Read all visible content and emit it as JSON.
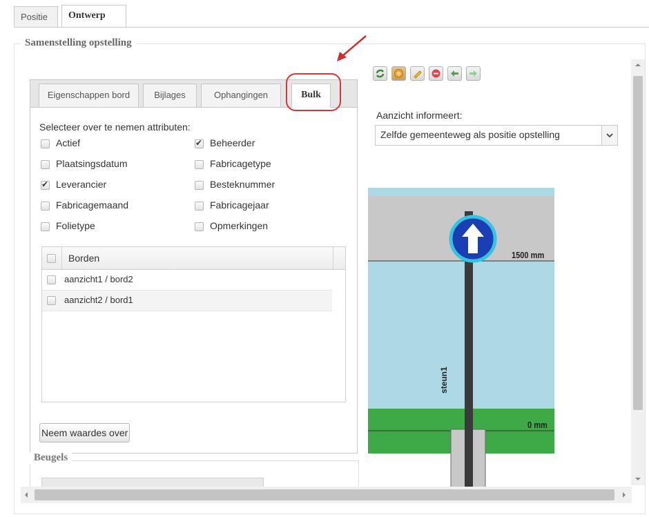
{
  "top_tabs": [
    {
      "label": "Positie"
    },
    {
      "label": "Ontwerp"
    }
  ],
  "fieldset_title": "Samenstelling opstelling",
  "inner_tabs": [
    {
      "label": "Eigenschappen bord"
    },
    {
      "label": "Bijlages"
    },
    {
      "label": "Ophangingen"
    },
    {
      "label": "Bulk"
    }
  ],
  "select_heading": "Selecteer over te nemen attributen:",
  "attributes_left": [
    {
      "label": "Actief",
      "checked": false
    },
    {
      "label": "Plaatsingsdatum",
      "checked": false
    },
    {
      "label": "Leverancier",
      "checked": true
    },
    {
      "label": "Fabricagemaand",
      "checked": false
    },
    {
      "label": "Folietype",
      "checked": false
    }
  ],
  "attributes_right": [
    {
      "label": "Beheerder",
      "checked": true
    },
    {
      "label": "Fabricagetype",
      "checked": false
    },
    {
      "label": "Besteknummer",
      "checked": false
    },
    {
      "label": "Fabricagejaar",
      "checked": false
    },
    {
      "label": "Opmerkingen",
      "checked": false
    }
  ],
  "grid": {
    "header": "Borden",
    "rows": [
      {
        "label": "aanzicht1 / bord2"
      },
      {
        "label": "aanzicht2 / bord1"
      }
    ]
  },
  "apply_button": "Neem waardes over",
  "beugels_title": "Beugels",
  "toolbar_icons": [
    "refresh-icon",
    "sign-icon",
    "edit-icon",
    "delete-icon",
    "arrow-left-icon",
    "arrow-right-icon"
  ],
  "view_label": "Aanzicht informeert:",
  "view_select": "Zelfde gemeenteweg als positie opstelling",
  "drawing": {
    "height_top": "1500 mm",
    "height_ground": "0 mm",
    "post_label": "steun1"
  },
  "colors": {
    "highlight": "#d9343a",
    "sky": "#add8e6",
    "grass": "#3daa47",
    "sign": "#1a3fb5"
  }
}
